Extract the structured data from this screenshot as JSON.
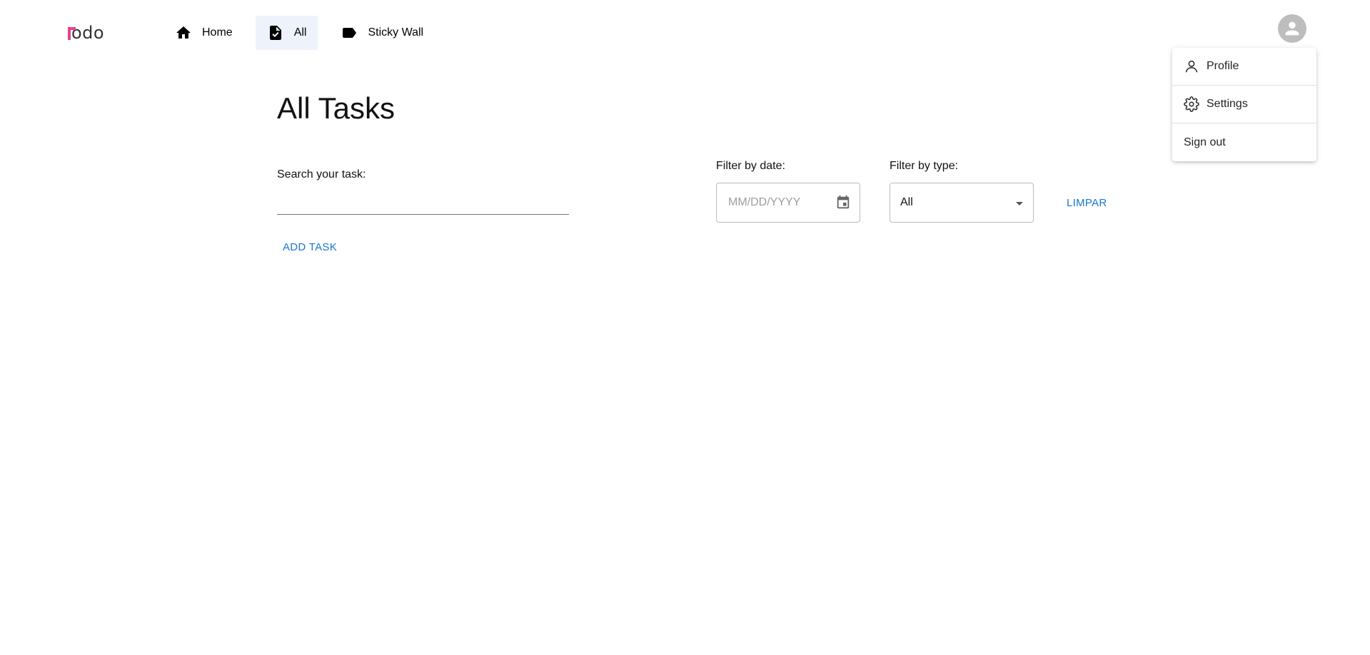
{
  "logo": {
    "text": "odo"
  },
  "nav": {
    "home": {
      "label": "Home",
      "icon": "home-icon"
    },
    "all": {
      "label": "All",
      "icon": "task-document-icon",
      "active": true
    },
    "sticky": {
      "label": "Sticky Wall",
      "icon": "label-tag-icon"
    }
  },
  "user_menu": {
    "profile": "Profile",
    "settings": "Settings",
    "sign_out": "Sign out"
  },
  "main": {
    "title": "All Tasks",
    "search_label": "Search your task:",
    "search_value": "",
    "add_task": "ADD TASK",
    "filter_date_label": "Filter by date:",
    "filter_date_placeholder": "MM/DD/YYYY",
    "filter_type_label": "Filter by type:",
    "filter_type_value": "All",
    "clear_button": "LIMPAR"
  },
  "colors": {
    "accent": "#1976d2",
    "brand": "#e83e8c",
    "active_nav_bg": "#eef3fb"
  }
}
